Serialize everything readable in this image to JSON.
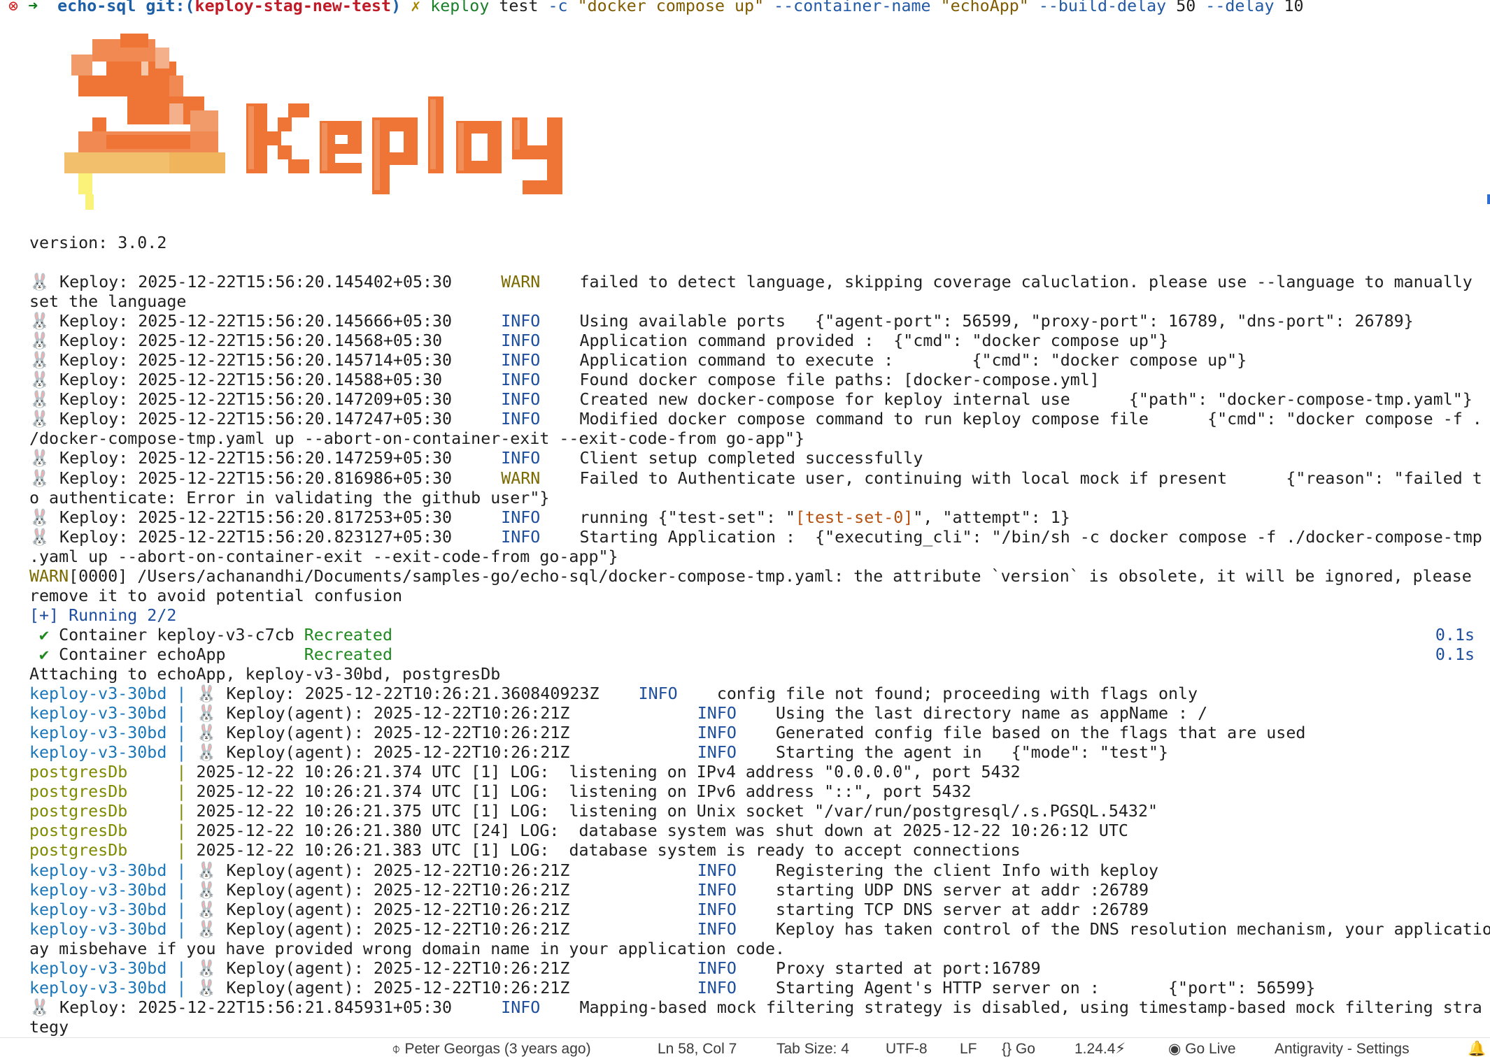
{
  "prompt": {
    "status_icon": "close-circle-icon",
    "arrow": "➜",
    "dir": "echo-sql",
    "git_label": "git:(",
    "branch": "keploy-stag-new-test",
    "git_close": ")",
    "dirty": "✗",
    "cmd": "keploy",
    "subcmd": " test ",
    "f1": "-c",
    "s1": " \"docker compose up\" ",
    "f2": "--container-name",
    "s2": " \"echoApp\" ",
    "f3": "--build-delay",
    "v3": " 50 ",
    "f4": "--delay",
    "v4": " 10"
  },
  "logo": {
    "brand": "Keploy",
    "colors": {
      "primary": "#ee7535",
      "light": "#f2c06c",
      "yellow": "#fbf27a"
    }
  },
  "version_line": "version: 3.0.2",
  "lines": [
    {
      "t": "log",
      "ts": "2025-12-22T15:56:20.145402+05:30",
      "lvl": "WARN",
      "msg": "failed to detect language, skipping coverage caluclation. please use --language to manually"
    },
    {
      "t": "plain",
      "text": "set the language"
    },
    {
      "t": "log",
      "ts": "2025-12-22T15:56:20.145666+05:30",
      "lvl": "INFO",
      "msg": "Using available ports   {\"agent-port\": 56599, \"proxy-port\": 16789, \"dns-port\": 26789}"
    },
    {
      "t": "log",
      "ts": "2025-12-22T15:56:20.14568+05:30 ",
      "lvl": "INFO",
      "msg": "Application command provided :  {\"cmd\": \"docker compose up\"}"
    },
    {
      "t": "log",
      "ts": "2025-12-22T15:56:20.145714+05:30",
      "lvl": "INFO",
      "msg": "Application command to execute :        {\"cmd\": \"docker compose up\"}"
    },
    {
      "t": "log",
      "ts": "2025-12-22T15:56:20.14588+05:30 ",
      "lvl": "INFO",
      "msg": "Found docker compose file paths: [docker-compose.yml]"
    },
    {
      "t": "log",
      "ts": "2025-12-22T15:56:20.147209+05:30",
      "lvl": "INFO",
      "msg": "Created new docker-compose for keploy internal use      {\"path\": \"docker-compose-tmp.yaml\"}"
    },
    {
      "t": "log",
      "ts": "2025-12-22T15:56:20.147247+05:30",
      "lvl": "INFO",
      "msg": "Modified docker compose command to run keploy compose file      {\"cmd\": \"docker compose -f ."
    },
    {
      "t": "plain",
      "text": "/docker-compose-tmp.yaml up --abort-on-container-exit --exit-code-from go-app\"}"
    },
    {
      "t": "log",
      "ts": "2025-12-22T15:56:20.147259+05:30",
      "lvl": "INFO",
      "msg": "Client setup completed successfully"
    },
    {
      "t": "log",
      "ts": "2025-12-22T15:56:20.816986+05:30",
      "lvl": "WARN",
      "msg": "Failed to Authenticate user, continuing with local mock if present      {\"reason\": \"failed t"
    },
    {
      "t": "plain",
      "text": "o authenticate: Error in validating the github user\"}"
    },
    {
      "t": "running",
      "ts": "2025-12-22T15:56:20.817253+05:30",
      "lvl": "INFO",
      "pre": "running {\"test-set\": \"",
      "set": "[test-set-0]",
      "post": "\", \"attempt\": 1}"
    },
    {
      "t": "log",
      "ts": "2025-12-22T15:56:20.823127+05:30",
      "lvl": "INFO",
      "msg": "Starting Application :  {\"executing_cli\": \"/bin/sh -c docker compose -f ./docker-compose-tmp"
    },
    {
      "t": "plain",
      "text": ".yaml up --abort-on-container-exit --exit-code-from go-app\"}"
    },
    {
      "t": "warnplain",
      "head": "WARN",
      "text": "[0000] /Users/achanandhi/Documents/samples-go/echo-sql/docker-compose-tmp.yaml: the attribute `version` is obsolete, it will be ignored, please"
    },
    {
      "t": "plain",
      "text": "remove it to avoid potential confusion"
    },
    {
      "t": "running2",
      "text": "[+] Running 2/2"
    },
    {
      "t": "container",
      "check": "✔",
      "name": " Container keploy-v3-c7cb ",
      "status": "Recreated",
      "time": "0.1s"
    },
    {
      "t": "container",
      "check": "✔",
      "name": " Container echoApp        ",
      "status": "Recreated",
      "time": "0.1s"
    },
    {
      "t": "plain",
      "text": "Attaching to echoApp, keploy-v3-30bd, postgresDb"
    },
    {
      "t": "klog",
      "src": "keploy-v3-30bd ",
      "sep": "| ",
      "who": "Keploy: ",
      "ts": "2025-12-22T10:26:21.360840923Z",
      "lvl": "INFO",
      "msg": "config file not found; proceeding with flags only"
    },
    {
      "t": "klog",
      "src": "keploy-v3-30bd ",
      "sep": "| ",
      "who": "Keploy(agent): ",
      "ts": "2025-12-22T10:26:21Z         ",
      "lvl": "INFO",
      "msg": "Using the last directory name as appName : /"
    },
    {
      "t": "klog",
      "src": "keploy-v3-30bd ",
      "sep": "| ",
      "who": "Keploy(agent): ",
      "ts": "2025-12-22T10:26:21Z         ",
      "lvl": "INFO",
      "msg": "Generated config file based on the flags that are used"
    },
    {
      "t": "klog",
      "src": "keploy-v3-30bd ",
      "sep": "| ",
      "who": "Keploy(agent): ",
      "ts": "2025-12-22T10:26:21Z         ",
      "lvl": "INFO",
      "msg": "Starting the agent in   {\"mode\": \"test\"}"
    },
    {
      "t": "plog",
      "src": "postgresDb     ",
      "sep": "| ",
      "msg": "2025-12-22 10:26:21.374 UTC [1] LOG:  listening on IPv4 address \"0.0.0.0\", port 5432"
    },
    {
      "t": "plog",
      "src": "postgresDb     ",
      "sep": "| ",
      "msg": "2025-12-22 10:26:21.374 UTC [1] LOG:  listening on IPv6 address \"::\", port 5432"
    },
    {
      "t": "plog",
      "src": "postgresDb     ",
      "sep": "| ",
      "msg": "2025-12-22 10:26:21.375 UTC [1] LOG:  listening on Unix socket \"/var/run/postgresql/.s.PGSQL.5432\""
    },
    {
      "t": "plog",
      "src": "postgresDb     ",
      "sep": "| ",
      "msg": "2025-12-22 10:26:21.380 UTC [24] LOG:  database system was shut down at 2025-12-22 10:26:12 UTC"
    },
    {
      "t": "plog",
      "src": "postgresDb     ",
      "sep": "| ",
      "msg": "2025-12-22 10:26:21.383 UTC [1] LOG:  database system is ready to accept connections"
    },
    {
      "t": "klog",
      "src": "keploy-v3-30bd ",
      "sep": "| ",
      "who": "Keploy(agent): ",
      "ts": "2025-12-22T10:26:21Z         ",
      "lvl": "INFO",
      "msg": "Registering the client Info with keploy"
    },
    {
      "t": "klog",
      "src": "keploy-v3-30bd ",
      "sep": "| ",
      "who": "Keploy(agent): ",
      "ts": "2025-12-22T10:26:21Z         ",
      "lvl": "INFO",
      "msg": "starting UDP DNS server at addr :26789"
    },
    {
      "t": "klog",
      "src": "keploy-v3-30bd ",
      "sep": "| ",
      "who": "Keploy(agent): ",
      "ts": "2025-12-22T10:26:21Z         ",
      "lvl": "INFO",
      "msg": "starting TCP DNS server at addr :26789"
    },
    {
      "t": "klog",
      "src": "keploy-v3-30bd ",
      "sep": "| ",
      "who": "Keploy(agent): ",
      "ts": "2025-12-22T10:26:21Z         ",
      "lvl": "INFO",
      "msg": "Keploy has taken control of the DNS resolution mechanism, your application m"
    },
    {
      "t": "plain",
      "text": "ay misbehave if you have provided wrong domain name in your application code."
    },
    {
      "t": "klog",
      "src": "keploy-v3-30bd ",
      "sep": "| ",
      "who": "Keploy(agent): ",
      "ts": "2025-12-22T10:26:21Z         ",
      "lvl": "INFO",
      "msg": "Proxy started at port:16789"
    },
    {
      "t": "klog",
      "src": "keploy-v3-30bd ",
      "sep": "| ",
      "who": "Keploy(agent): ",
      "ts": "2025-12-22T10:26:21Z         ",
      "lvl": "INFO",
      "msg": "Starting Agent's HTTP server on :       {\"port\": 56599}"
    },
    {
      "t": "log",
      "ts": "2025-12-22T15:56:21.845931+05:30",
      "lvl": "INFO",
      "msg": "Mapping-based mock filtering strategy is disabled, using timestamp-based mock filtering stra"
    },
    {
      "t": "plain",
      "text": "tegy"
    }
  ],
  "log_prefix": " Keploy: ",
  "rabbit": "🐰",
  "statusbar": {
    "blame_icon": "git-commit-icon",
    "blame": "Peter Georgas (3 years ago)",
    "position": "Ln 58, Col 7",
    "tab_size": "Tab Size: 4",
    "encoding": "UTF-8",
    "eol": "LF",
    "language_icon": "braces-icon",
    "language": "Go",
    "go_version": "1.24.4",
    "go_version_icon": "lightning-icon",
    "live_icon": "broadcast-icon",
    "golive": "Go Live",
    "settings": "Antigravity - Settings",
    "bell_icon": "bell-icon"
  }
}
